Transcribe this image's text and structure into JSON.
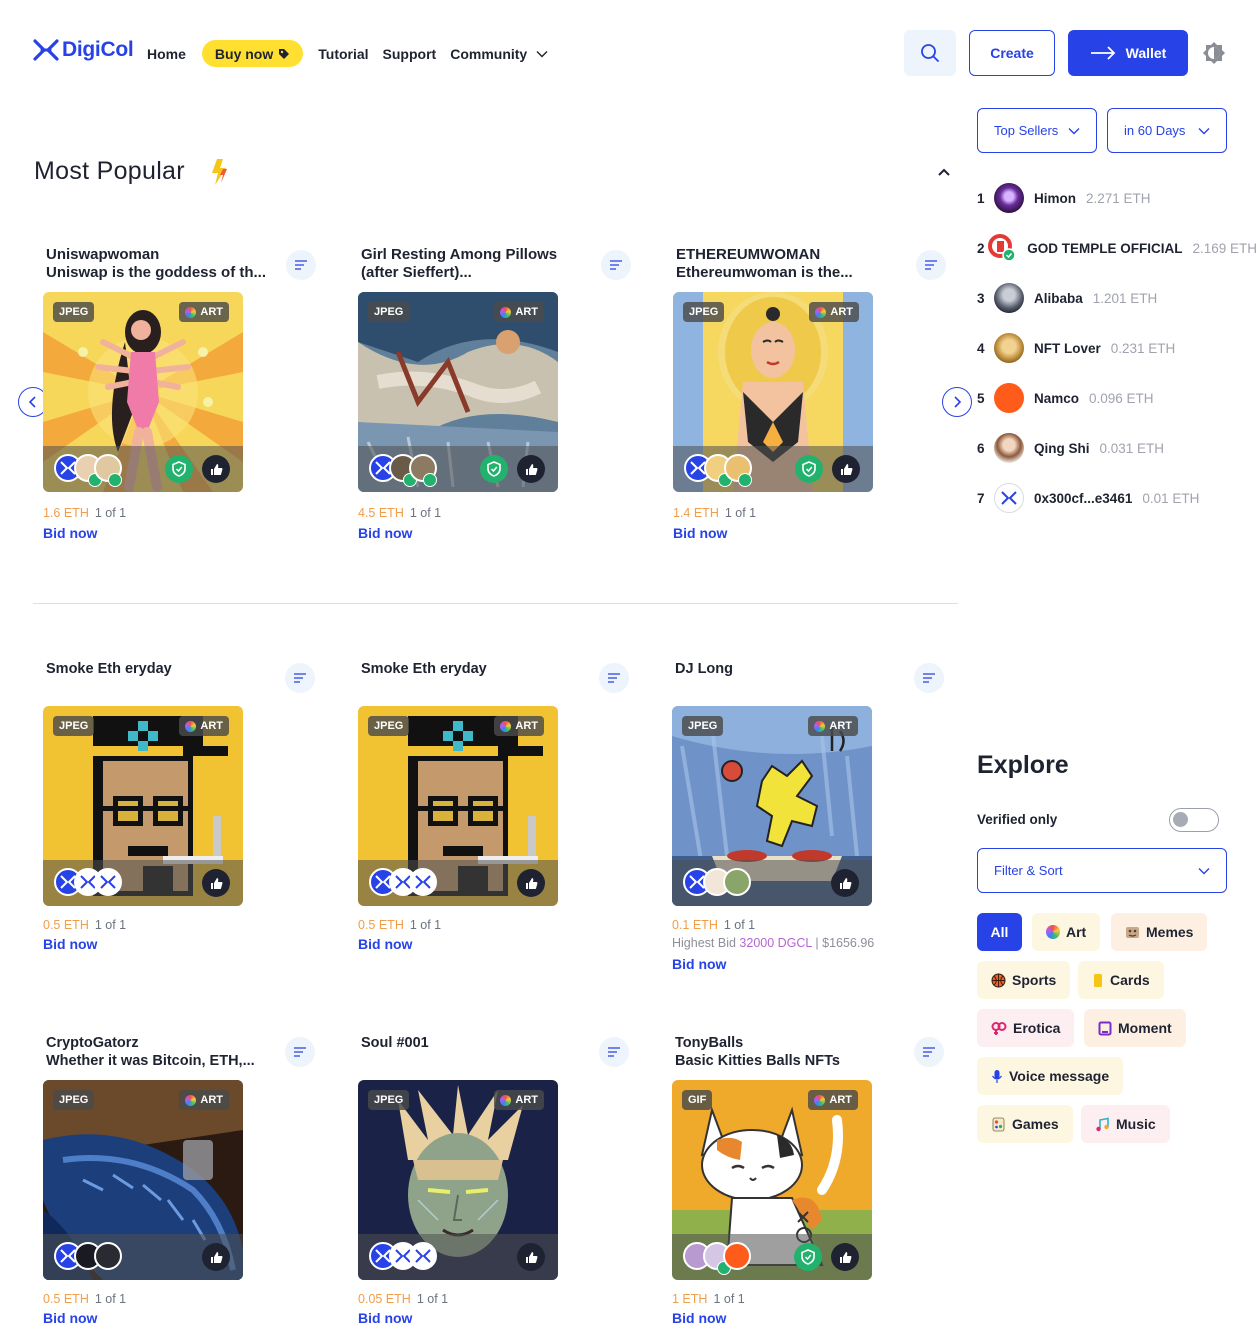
{
  "header": {
    "logo_text": "DigiCol",
    "nav": {
      "home": "Home",
      "buy_now": "Buy now",
      "tutorial": "Tutorial",
      "support": "Support",
      "community": "Community"
    },
    "create_label": "Create",
    "wallet_label": "Wallet"
  },
  "popular": {
    "title": "Most Popular",
    "cards": [
      {
        "title": "Uniswapwoman",
        "subtitle": "Uniswap is the goddess of th...",
        "type": "JPEG",
        "category": "ART",
        "price": "1.6 ETH",
        "edition": "1 of 1",
        "bid": "Bid now"
      },
      {
        "title": "Girl Resting Among Pillows",
        "subtitle": "(after Sieffert)...",
        "type": "JPEG",
        "category": "ART",
        "price": "4.5 ETH",
        "edition": "1 of 1",
        "bid": "Bid now"
      },
      {
        "title": "ETHEREUMWOMAN",
        "subtitle": "Ethereumwoman is the...",
        "type": "JPEG",
        "category": "ART",
        "price": "1.4 ETH",
        "edition": "1 of 1",
        "bid": "Bid now"
      }
    ]
  },
  "grid": [
    {
      "title": "Smoke Eth eryday",
      "subtitle": "",
      "type": "JPEG",
      "category": "ART",
      "price": "0.5 ETH",
      "edition": "1 of 1",
      "bid": "Bid now"
    },
    {
      "title": "Smoke Eth eryday",
      "subtitle": "",
      "type": "JPEG",
      "category": "ART",
      "price": "0.5 ETH",
      "edition": "1 of 1",
      "bid": "Bid now"
    },
    {
      "title": "DJ Long",
      "subtitle": "",
      "type": "JPEG",
      "category": "ART",
      "price": "0.1 ETH",
      "edition": "1 of 1",
      "highest_label": "Highest Bid",
      "highest_amount": "32000 DGCL",
      "highest_usd": "| $1656.96",
      "bid": "Bid now"
    },
    {
      "title": "CryptoGatorz",
      "subtitle": "Whether it was Bitcoin, ETH,...",
      "type": "JPEG",
      "category": "ART",
      "price": "0.5 ETH",
      "edition": "1 of 1",
      "bid": "Bid now"
    },
    {
      "title": "Soul #001",
      "subtitle": "",
      "type": "JPEG",
      "category": "ART",
      "price": "0.05 ETH",
      "edition": "1 of 1",
      "bid": "Bid now"
    },
    {
      "title": "TonyBalls",
      "subtitle": "Basic Kitties Balls NFTs",
      "type": "GIF",
      "category": "ART",
      "price": "1 ETH",
      "edition": "1 of 1",
      "bid": "Bid now"
    }
  ],
  "sidebar": {
    "sellers_filter": "Top Sellers",
    "period_filter": "in 60 Days",
    "sellers": [
      {
        "rank": "1",
        "name": "Himon",
        "amount": "2.271 ETH"
      },
      {
        "rank": "2",
        "name": "GOD TEMPLE OFFICIAL",
        "amount": "2.169 ETH"
      },
      {
        "rank": "3",
        "name": "Alibaba",
        "amount": "1.201 ETH"
      },
      {
        "rank": "4",
        "name": "NFT Lover",
        "amount": "0.231 ETH"
      },
      {
        "rank": "5",
        "name": "Namco",
        "amount": "0.096 ETH"
      },
      {
        "rank": "6",
        "name": "Qing Shi",
        "amount": "0.031 ETH"
      },
      {
        "rank": "7",
        "name": "0x300cf...e3461",
        "amount": "0.01 ETH"
      }
    ],
    "explore_title": "Explore",
    "verified_label": "Verified only",
    "verified_on": false,
    "filter_sort": "Filter & Sort",
    "categories": [
      "All",
      "Art",
      "Memes",
      "Sports",
      "Cards",
      "Erotica",
      "Moment",
      "Voice message",
      "Games",
      "Music"
    ]
  },
  "colors": {
    "accent": "#2742e6",
    "price": "#f29d49",
    "buy_now_bg": "#ffe030",
    "verified": "#23b26d"
  }
}
